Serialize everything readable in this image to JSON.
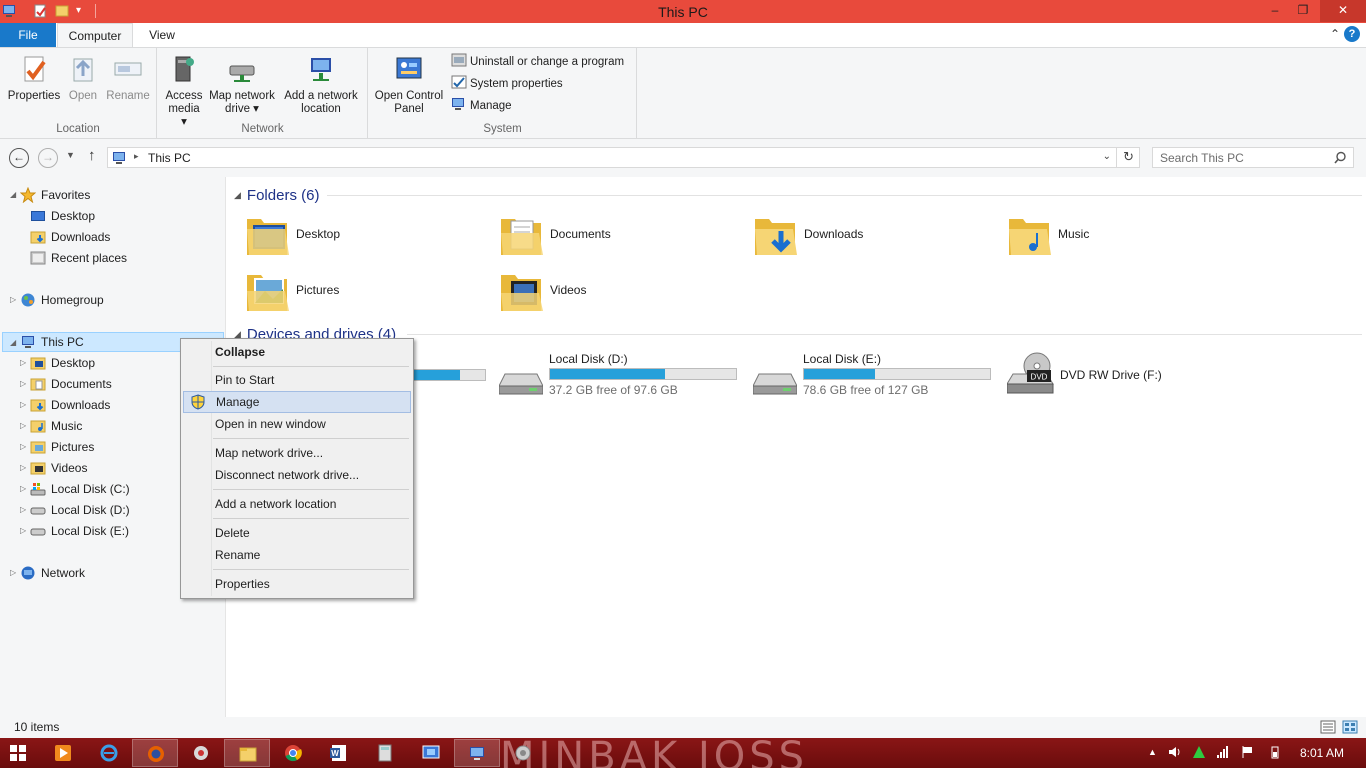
{
  "window": {
    "title": "This PC"
  },
  "ribbon": {
    "tabs": [
      "File",
      "Computer",
      "View"
    ],
    "groups": {
      "location": {
        "label": "Location",
        "buttons": [
          "Properties",
          "Open",
          "Rename"
        ]
      },
      "network": {
        "label": "Network",
        "buttons": [
          [
            "Access",
            "media ▾"
          ],
          [
            "Map network",
            "drive ▾"
          ],
          [
            "Add a network",
            "location"
          ]
        ]
      },
      "system": {
        "label": "System",
        "open_cp": [
          "Open Control",
          "Panel"
        ],
        "small": [
          "Uninstall or change a program",
          "System properties",
          "Manage"
        ]
      }
    }
  },
  "address": {
    "path": "This PC",
    "search_placeholder": "Search This PC"
  },
  "nav": {
    "favorites": "Favorites",
    "favorites_items": [
      "Desktop",
      "Downloads",
      "Recent places"
    ],
    "homegroup": "Homegroup",
    "thispc": "This PC",
    "thispc_items": [
      "Desktop",
      "Documents",
      "Downloads",
      "Music",
      "Pictures",
      "Videos",
      "Local Disk (C:)",
      "Local Disk (D:)",
      "Local Disk (E:)"
    ],
    "network": "Network"
  },
  "content": {
    "folders_header": "Folders (6)",
    "folders": [
      "Desktop",
      "Documents",
      "Downloads",
      "Music",
      "Pictures",
      "Videos"
    ],
    "devices_header": "Devices and drives (4)",
    "drives": [
      {
        "name": "Local Disk (D:)",
        "free": "37.2 GB free of 97.6 GB",
        "used_fraction": 0.62
      },
      {
        "name": "Local Disk (E:)",
        "free": "78.6 GB free of 127 GB",
        "used_fraction": 0.38
      }
    ],
    "partial_drive_used_fraction": 0.65,
    "dvd": {
      "name": "DVD RW Drive (F:)",
      "label": "DVD"
    }
  },
  "context_menu": {
    "items": [
      "Collapse",
      "Pin to Start",
      "Manage",
      "Open in new window",
      "Map network drive...",
      "Disconnect network drive...",
      "Add a network location",
      "Delete",
      "Rename",
      "Properties"
    ]
  },
  "status": {
    "items": "10 items"
  },
  "taskbar": {
    "watermark": "MINBAK JOSS",
    "time": "8:01 AM"
  }
}
